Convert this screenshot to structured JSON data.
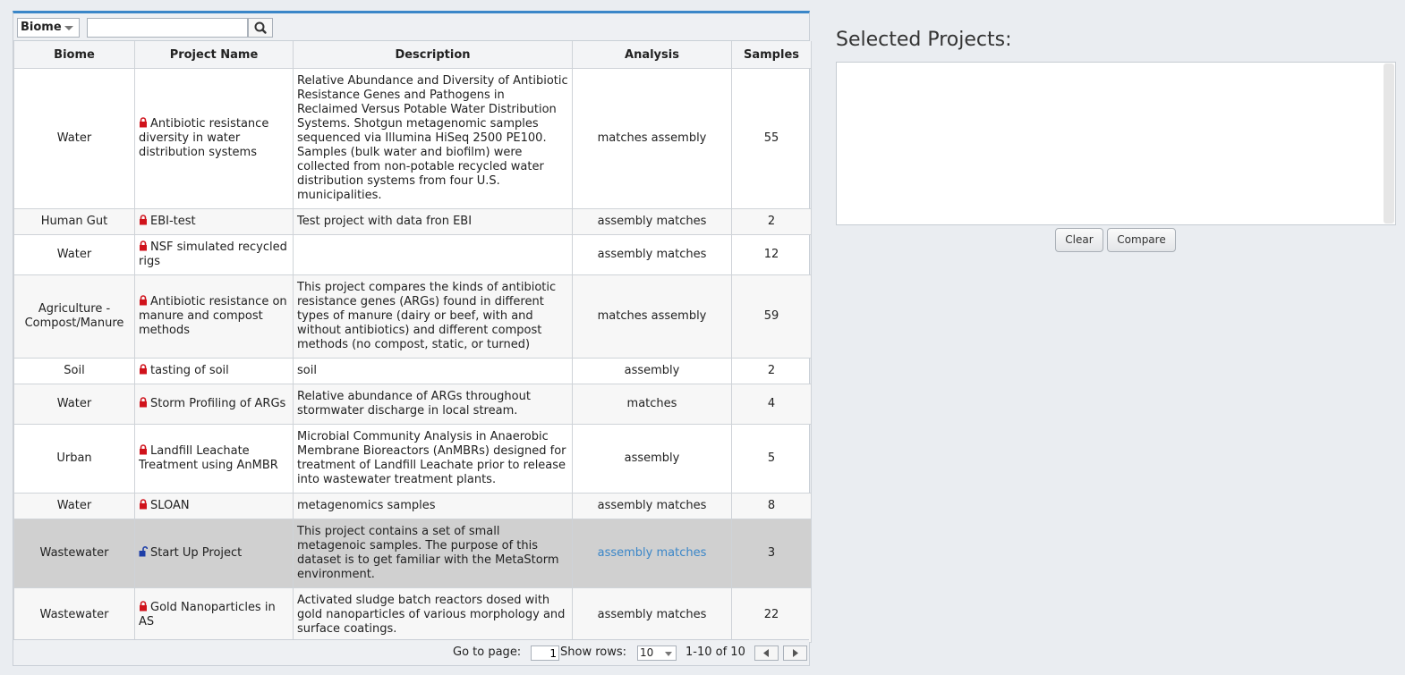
{
  "toolbar": {
    "filter_select": "Biome",
    "search_placeholder": ""
  },
  "table": {
    "headers": [
      "Biome",
      "Project Name",
      "Description",
      "Analysis",
      "Samples"
    ],
    "rows": [
      {
        "biome": "Water",
        "name": "Antibiotic resistance diversity in water distribution systems",
        "description": "Relative Abundance and Diversity of Antibiotic Resistance Genes and Pathogens in Reclaimed Versus Potable Water Distribution Systems. Shotgun metagenomic samples sequenced via Illumina HiSeq 2500 PE100. Samples (bulk water and biofilm) were collected from non-potable recycled water distribution systems from four U.S. municipalities.",
        "analysis": "matches assembly",
        "samples": "55"
      },
      {
        "biome": "Human Gut",
        "name": "EBI-test",
        "description": "Test project with data fron EBI",
        "analysis": "assembly matches",
        "samples": "2"
      },
      {
        "biome": "Water",
        "name": "NSF simulated recycled rigs",
        "description": "",
        "analysis": "assembly matches",
        "samples": "12"
      },
      {
        "biome": "Agriculture - Compost/Manure",
        "name": "Antibiotic resistance on manure and compost methods",
        "description": "This project compares the kinds of antibiotic resistance genes (ARGs) found in different types of manure (dairy or beef, with and without antibiotics) and different compost methods (no compost, static, or turned)",
        "analysis": "matches assembly",
        "samples": "59"
      },
      {
        "biome": "Soil",
        "name": "tasting of soil",
        "description": "soil",
        "analysis": "assembly",
        "samples": "2"
      },
      {
        "biome": "Water",
        "name": "Storm Profiling of ARGs",
        "description": "Relative abundance of ARGs throughout stormwater discharge in local stream.",
        "analysis": "matches",
        "samples": "4"
      },
      {
        "biome": "Urban",
        "name": "Landfill Leachate Treatment using AnMBR",
        "description": "Microbial Community Analysis in Anaerobic Membrane Bioreactors (AnMBRs) designed for treatment of Landfill Leachate prior to release into wastewater treatment plants.",
        "analysis": "assembly",
        "samples": "5"
      },
      {
        "biome": "Water",
        "name": "SLOAN",
        "description": "metagenomics samples",
        "analysis": "assembly matches",
        "samples": "8"
      },
      {
        "biome": "Wastewater",
        "name": "Start Up Project",
        "description": "This project contains a set of small metagenoic samples. The purpose of this dataset is to get familiar with the MetaStorm environment.",
        "analysis": "assembly matches",
        "samples": "3"
      },
      {
        "biome": "Wastewater",
        "name": "Gold Nanoparticles in AS",
        "description": "Activated sludge batch reactors dosed with gold nanoparticles of various morphology and surface coatings.",
        "analysis": "assembly matches",
        "samples": "22"
      }
    ]
  },
  "footer": {
    "goto_label": "Go to page:",
    "page_value": "1",
    "rows_label": "Show rows:",
    "rows_value": "10",
    "range_text": "1-10 of 10"
  },
  "selected": {
    "title": "Selected Projects:",
    "clear_label": "Clear",
    "compare_label": "Compare"
  },
  "colors": {
    "accent": "#3a86c8",
    "lock_closed": "#d0121b",
    "lock_open": "#1e3fa8",
    "selected_row": "#d0d0d0"
  },
  "icons": {
    "search": "search-icon",
    "locked": "lock-icon",
    "unlocked": "unlock-icon"
  }
}
